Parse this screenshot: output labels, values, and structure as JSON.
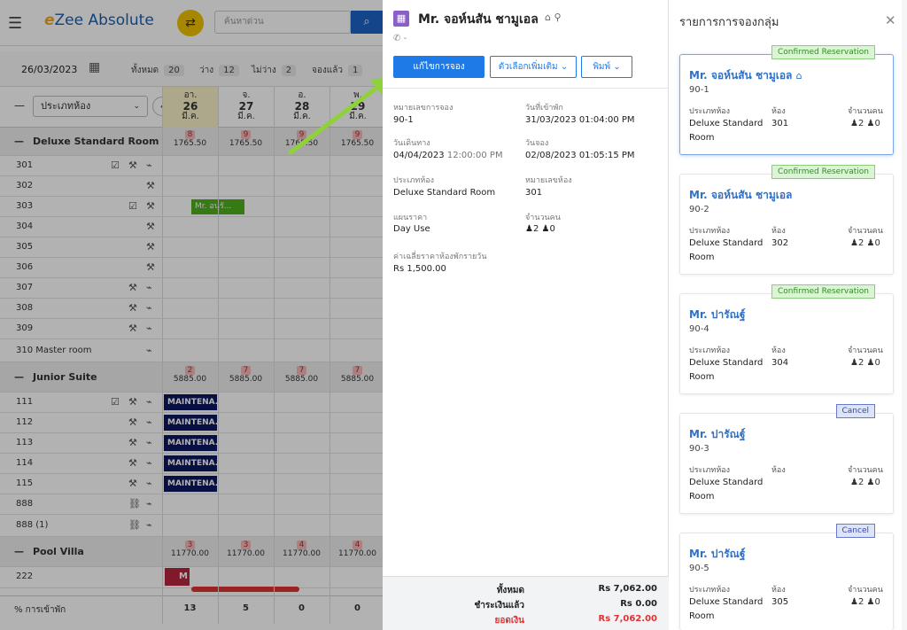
{
  "app": {
    "title_prefix": "e",
    "title_rest": "Zee Absolute"
  },
  "topbar": {
    "search_placeholder": "ค้นหาด่วน"
  },
  "stats": {
    "date": "26/03/2023",
    "total_label": "ทั้งหมด",
    "total": "20",
    "vacant_label": "ว่าง",
    "vacant": "12",
    "occupied_label": "ไม่ว่าง",
    "occupied": "2",
    "booked_label": "จองแล้ว",
    "booked": "1"
  },
  "grid": {
    "room_type_select": "ประเภทห้อง",
    "dates": [
      {
        "dow": "อา.",
        "day": "26",
        "mon": "มี.ค."
      },
      {
        "dow": "จ.",
        "day": "27",
        "mon": "มี.ค."
      },
      {
        "dow": "อ.",
        "day": "28",
        "mon": "มี.ค."
      },
      {
        "dow": "พ.",
        "day": "29",
        "mon": "มี.ค."
      }
    ],
    "groups": [
      {
        "name": "Deluxe Standard Room",
        "avail": [
          "8",
          "9",
          "9",
          "9"
        ],
        "rate": [
          "1765.50",
          "1765.50",
          "1765.50",
          "1765.50"
        ]
      },
      {
        "name": "Junior Suite",
        "avail": [
          "2",
          "7",
          "7",
          "7"
        ],
        "rate": [
          "5885.00",
          "5885.00",
          "5885.00",
          "5885.00"
        ]
      },
      {
        "name": "Pool Villa",
        "avail": [
          "3",
          "3",
          "4",
          "4"
        ],
        "rate": [
          "11770.00",
          "11770.00",
          "11770.00",
          "11770.00"
        ]
      }
    ],
    "rooms_deluxe": [
      "301",
      "302",
      "303",
      "304",
      "305",
      "306",
      "307",
      "308",
      "309",
      "310 Master room"
    ],
    "rooms_junior": [
      "111",
      "112",
      "113",
      "114",
      "115",
      "888",
      "888 (1)"
    ],
    "rooms_pool": [
      "222"
    ],
    "booking_303": "Mr. อนุรั...",
    "maintenance_label": "MAINTENA...",
    "pool_booking_label": "M",
    "occupancy_label": "% การเข้าพัก",
    "occupancy": [
      "13",
      "5",
      "0",
      "0"
    ]
  },
  "reservation": {
    "guest_name": "Mr. จอห์นสัน ชามูเอล",
    "phone": "-",
    "edit_button": "แก้ไขการจอง",
    "more_button": "ตัวเลือกเพิ่มเติม",
    "print_button": "พิมพ์",
    "res_no_label": "หมายเลขการจอง",
    "res_no": "90-1",
    "checkin_label": "วันที่เข้าพัก",
    "checkin": "31/03/2023 01:04:00 PM",
    "departure_label": "วันเดินทาง",
    "departure_date": "04/04/2023",
    "departure_time": "12:00:00 PM",
    "booked_label": "วันจอง",
    "booked": "02/08/2023 01:05:15 PM",
    "roomtype_label": "ประเภทห้อง",
    "roomtype": "Deluxe Standard Room",
    "roomno_label": "หมายเลขห้อง",
    "roomno": "301",
    "plan_label": "แผนราคา",
    "plan": "Day Use",
    "pax_label": "จำนวนคน",
    "adults": "2",
    "children": "0",
    "avg_label": "ค่าเฉลี่ยราคาห้องพักรายวัน",
    "avg": "Rs 1,500.00",
    "total_label": "ทั้งหมด",
    "total": "Rs 7,062.00",
    "paid_label": "ชำระเงินแล้ว",
    "paid": "Rs 0.00",
    "balance_label": "ยอดเงิน",
    "balance": "Rs 7,062.00"
  },
  "group_panel": {
    "title": "รายการการจองกลุ่ม",
    "roomtype_label": "ประเภทห้อง",
    "room_label": "ห้อง",
    "pax_label": "จำนวนคน",
    "cards": [
      {
        "status": "Confirmed Reservation",
        "name": "Mr. จอห์นสัน ชามูเอล",
        "no": "90-1",
        "rt1": "Deluxe Standard",
        "rt2": "Room",
        "room": "301",
        "adults": "2",
        "children": "0"
      },
      {
        "status": "Confirmed Reservation",
        "name": "Mr. จอห์นสัน ชามูเอล",
        "no": "90-2",
        "rt1": "Deluxe Standard",
        "rt2": "Room",
        "room": "302",
        "adults": "2",
        "children": "0"
      },
      {
        "status": "Confirmed Reservation",
        "name": "Mr. ปารัณฐ์",
        "no": "90-4",
        "rt1": "Deluxe Standard",
        "rt2": "Room",
        "room": "304",
        "adults": "2",
        "children": "0"
      },
      {
        "status": "Cancel",
        "name": "Mr. ปารัณฐ์",
        "no": "90-3",
        "rt1": "Deluxe Standard",
        "rt2": "Room",
        "room": "",
        "adults": "2",
        "children": "0"
      },
      {
        "status": "Cancel",
        "name": "Mr. ปารัณฐ์",
        "no": "90-5",
        "rt1": "Deluxe Standard",
        "rt2": "Room",
        "room": "305",
        "adults": "2",
        "children": "0"
      }
    ]
  }
}
